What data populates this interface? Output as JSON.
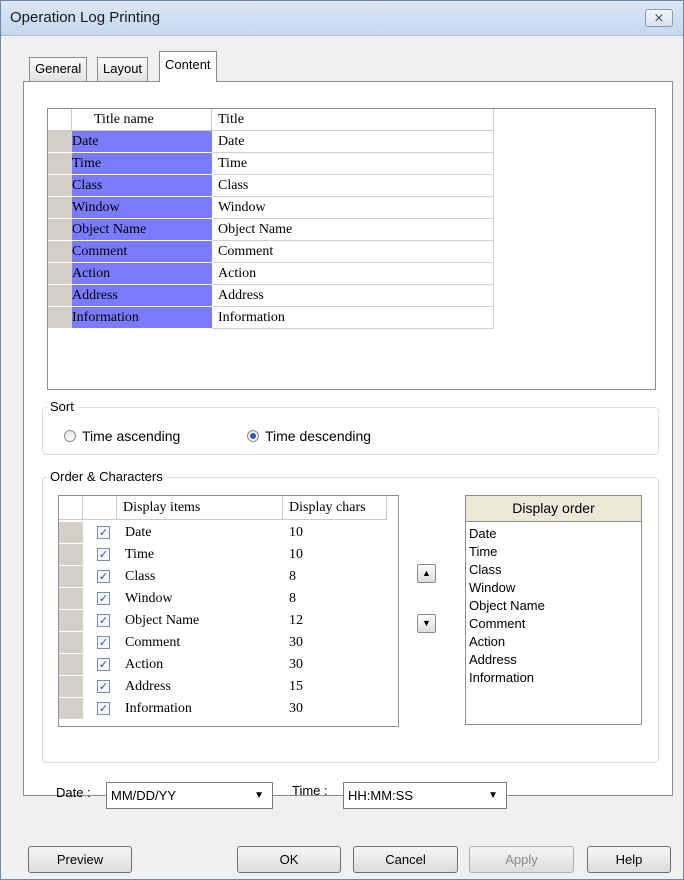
{
  "window": {
    "title": "Operation Log Printing",
    "close_glyph": "⨯"
  },
  "tabs": [
    {
      "label": "General"
    },
    {
      "label": "Layout"
    },
    {
      "label": "Content",
      "active": true
    }
  ],
  "title_grid": {
    "headers": [
      "Title name",
      "Title"
    ],
    "rows": [
      {
        "name": "Date",
        "title": "Date"
      },
      {
        "name": "Time",
        "title": "Time"
      },
      {
        "name": "Class",
        "title": "Class"
      },
      {
        "name": "Window",
        "title": "Window"
      },
      {
        "name": "Object Name",
        "title": "Object Name"
      },
      {
        "name": "Comment",
        "title": "Comment"
      },
      {
        "name": "Action",
        "title": "Action"
      },
      {
        "name": "Address",
        "title": "Address"
      },
      {
        "name": "Information",
        "title": "Information"
      }
    ],
    "selection_color": "#7b7bff"
  },
  "sort": {
    "label": "Sort",
    "options": [
      {
        "label": "Time ascending",
        "selected": false
      },
      {
        "label": "Time descending",
        "selected": true
      }
    ]
  },
  "order_characters": {
    "label": "Order & Characters",
    "headers": [
      "Display items",
      "Display chars"
    ],
    "rows": [
      {
        "item": "Date",
        "chars": "10",
        "checked": true
      },
      {
        "item": "Time",
        "chars": "10",
        "checked": true
      },
      {
        "item": "Class",
        "chars": "8",
        "checked": true
      },
      {
        "item": "Window",
        "chars": "8",
        "checked": true
      },
      {
        "item": "Object Name",
        "chars": "12",
        "checked": true
      },
      {
        "item": "Comment",
        "chars": "30",
        "checked": true
      },
      {
        "item": "Action",
        "chars": "30",
        "checked": true
      },
      {
        "item": "Address",
        "chars": "15",
        "checked": true
      },
      {
        "item": "Information",
        "chars": "30",
        "checked": true
      }
    ],
    "up_icon": "arrow-up-icon",
    "down_icon": "arrow-down-icon",
    "display_order": {
      "header": "Display order",
      "items": [
        "Date",
        "Time",
        "Class",
        "Window",
        "Object Name",
        "Comment",
        "Action",
        "Address",
        "Information"
      ]
    }
  },
  "formats": {
    "date_label": "Date :",
    "date_value": "MM/DD/YY",
    "time_label": "Time :",
    "time_value": "HH:MM:SS"
  },
  "buttons": {
    "preview": "Preview",
    "ok": "OK",
    "cancel": "Cancel",
    "apply": "Apply",
    "help": "Help"
  }
}
